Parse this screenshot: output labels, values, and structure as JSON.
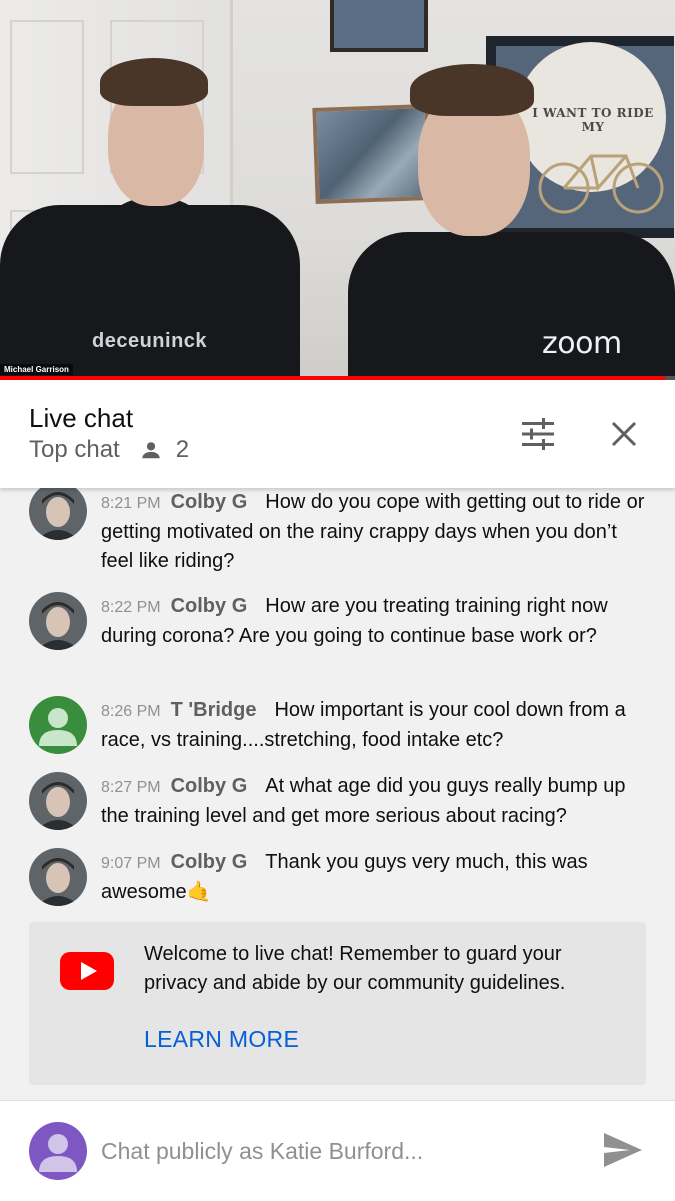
{
  "video": {
    "participant_name": "Michael Garrison",
    "poster_text": "I WANT TO RIDE MY",
    "jersey_text": "deceuninck",
    "watermark": "zoom",
    "progress": 0.985,
    "progress_color": "#ff0000"
  },
  "header": {
    "title": "Live chat",
    "mode": "Top chat",
    "viewer_icon": "person-icon",
    "viewer_count": "2",
    "filter_icon": "tune-icon",
    "close_icon": "close-icon"
  },
  "messages": [
    {
      "time": "8:21 PM",
      "author": "Colby G",
      "text": "How do you cope with getting out to ride or getting motivated on the rainy crappy days when you don’t feel like riding?",
      "avatar": "photo"
    },
    {
      "time": "8:22 PM",
      "author": "Colby G",
      "text": "How are you treating training right now during corona? Are you going to continue base work or?",
      "avatar": "photo"
    },
    {
      "time": "8:26 PM",
      "author": "T 'Bridge",
      "text": "How important is your cool down from a race, vs training....stretching, food intake etc?",
      "avatar": "default-green"
    },
    {
      "time": "8:27 PM",
      "author": "Colby G",
      "text": "At what age did you guys really bump up the training level and get more serious about racing?",
      "avatar": "photo"
    },
    {
      "time": "9:07 PM",
      "author": "Colby G",
      "text": "Thank you guys very much, this was awesome🤙",
      "avatar": "photo"
    }
  ],
  "welcome": {
    "icon": "youtube-icon",
    "text": "Welcome to live chat! Remember to guard your privacy and abide by our community guidelines.",
    "link": "LEARN MORE"
  },
  "input": {
    "placeholder": "Chat publicly as Katie Burford...",
    "send_icon": "send-icon"
  },
  "colors": {
    "link": "#065fd4",
    "youtube_red": "#ff0000",
    "green_avatar": "#388e3c",
    "purple_avatar": "#7e57c2"
  }
}
